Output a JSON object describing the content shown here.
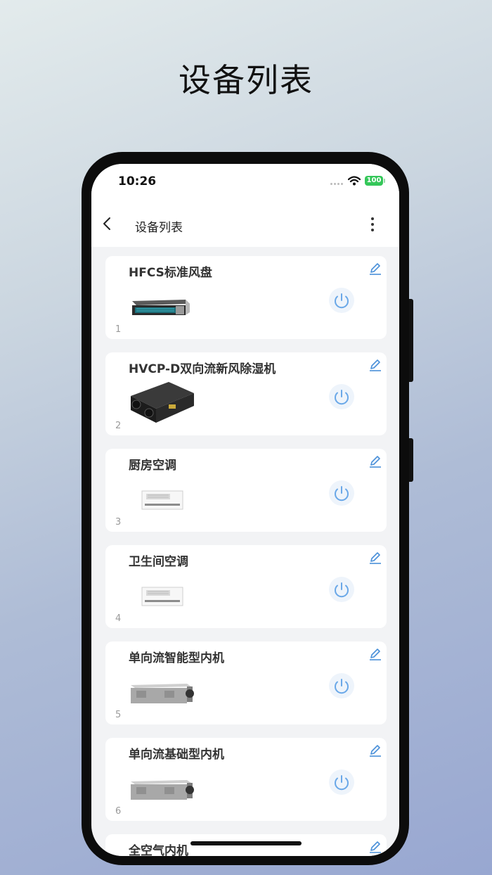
{
  "hero": {
    "title": "设备列表"
  },
  "status_bar": {
    "time": "10:26",
    "battery": "100"
  },
  "nav": {
    "title": "设备列表"
  },
  "devices": [
    {
      "name": "HFCS标准风盘",
      "index": "1",
      "image": "ducted-fan-coil"
    },
    {
      "name": "HVCP-D双向流新风除湿机",
      "index": "2",
      "image": "black-dehumidifier"
    },
    {
      "name": "厨房空调",
      "index": "3",
      "image": "white-ceiling-ac"
    },
    {
      "name": "卫生间空调",
      "index": "4",
      "image": "white-ceiling-ac"
    },
    {
      "name": "单向流智能型内机",
      "index": "5",
      "image": "silver-ventilator"
    },
    {
      "name": "单向流基础型内机",
      "index": "6",
      "image": "silver-ventilator"
    },
    {
      "name": "全空气内机",
      "index": "",
      "image": "air-handler"
    }
  ],
  "colors": {
    "accent": "#4a90d9",
    "power_icon": "#6aa8e8",
    "battery": "#34c759"
  }
}
